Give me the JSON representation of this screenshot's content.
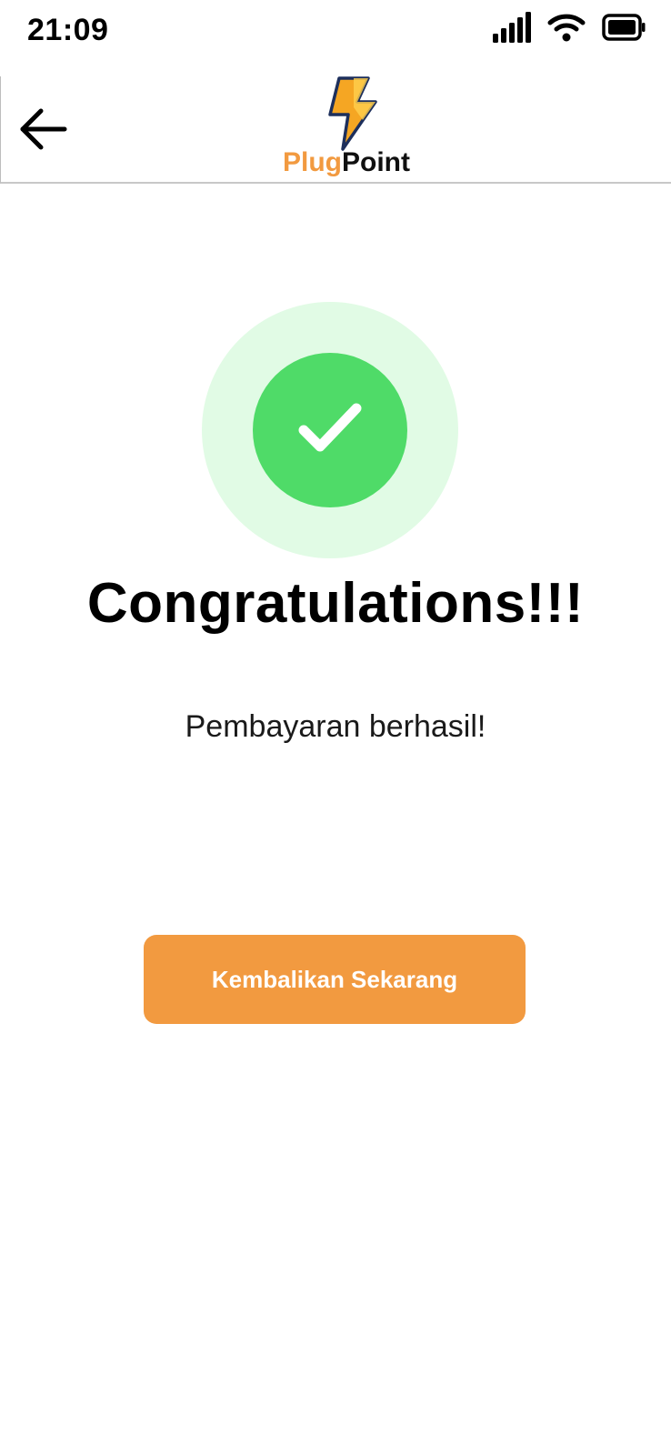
{
  "status_bar": {
    "time": "21:09",
    "signal_icon": "cellular-signal-icon",
    "wifi_icon": "wifi-icon",
    "battery_icon": "battery-icon"
  },
  "header": {
    "back_icon": "arrow-left-icon",
    "logo_icon": "lightning-bolt-icon",
    "logo_text_part1": "Plug",
    "logo_text_part2": "Point"
  },
  "success": {
    "icon": "checkmark-icon",
    "heading": "Congratulations!!!",
    "message": "Pembayaran berhasil!"
  },
  "actions": {
    "return_label": "Kembalikan Sekarang"
  },
  "colors": {
    "brand_orange": "#f29a40",
    "success_green": "#4fdb68",
    "success_light": "#e1fbe5"
  }
}
